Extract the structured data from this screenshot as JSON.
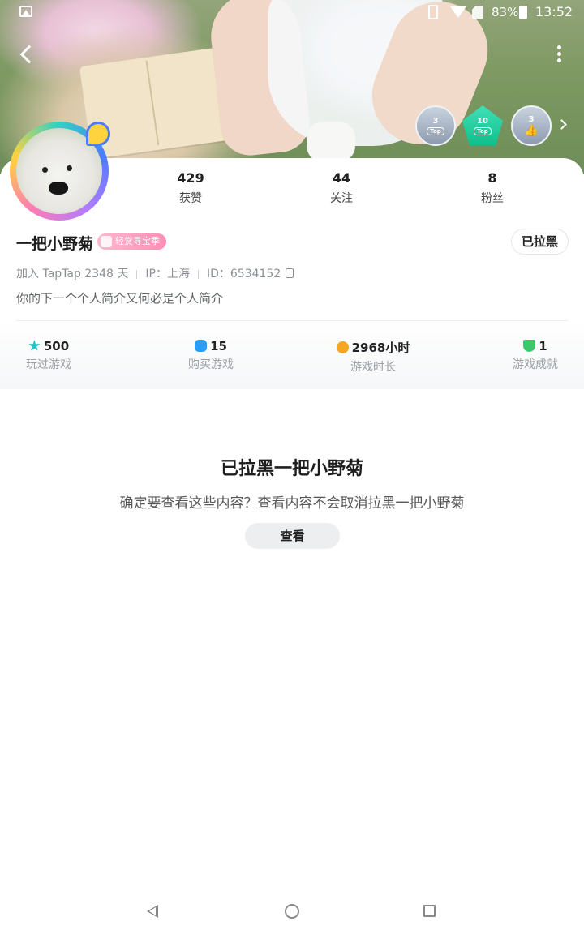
{
  "status_bar": {
    "battery": "83%",
    "time": "13:52"
  },
  "badges": [
    {
      "num": "3",
      "tag": "Top"
    },
    {
      "num": "10",
      "tag": "Top"
    },
    {
      "num": "3",
      "tag": ""
    }
  ],
  "profile": {
    "stats": [
      {
        "value": "429",
        "label": "获赞"
      },
      {
        "value": "44",
        "label": "关注"
      },
      {
        "value": "8",
        "label": "粉丝"
      }
    ],
    "username": "一把小野菊",
    "season_badge": "轻赏寻宝季",
    "blocked_button": "已拉黑",
    "joined": "加入 TapTap 2348 天",
    "ip": "IP：上海",
    "id": "ID：6534152",
    "bio": "你的下一个个人简介又何必是个人简介"
  },
  "game_stats": [
    {
      "value": "500",
      "label": "玩过游戏",
      "icon": "star-icon"
    },
    {
      "value": "15",
      "label": "购买游戏",
      "icon": "gamepad-icon"
    },
    {
      "value": "2968小时",
      "label": "游戏时长",
      "icon": "timer-icon"
    },
    {
      "value": "1",
      "label": "游戏成就",
      "icon": "trophy-icon"
    }
  ],
  "notice": {
    "title": "已拉黑一把小野菊",
    "text": "确定要查看这些内容？查看内容不会取消拉黑一把小野菊",
    "button": "查看"
  },
  "colors": {
    "accent_teal": "#20c4c6",
    "pink_badge": "#ff8fb5",
    "gray_text": "#8a8f95"
  }
}
